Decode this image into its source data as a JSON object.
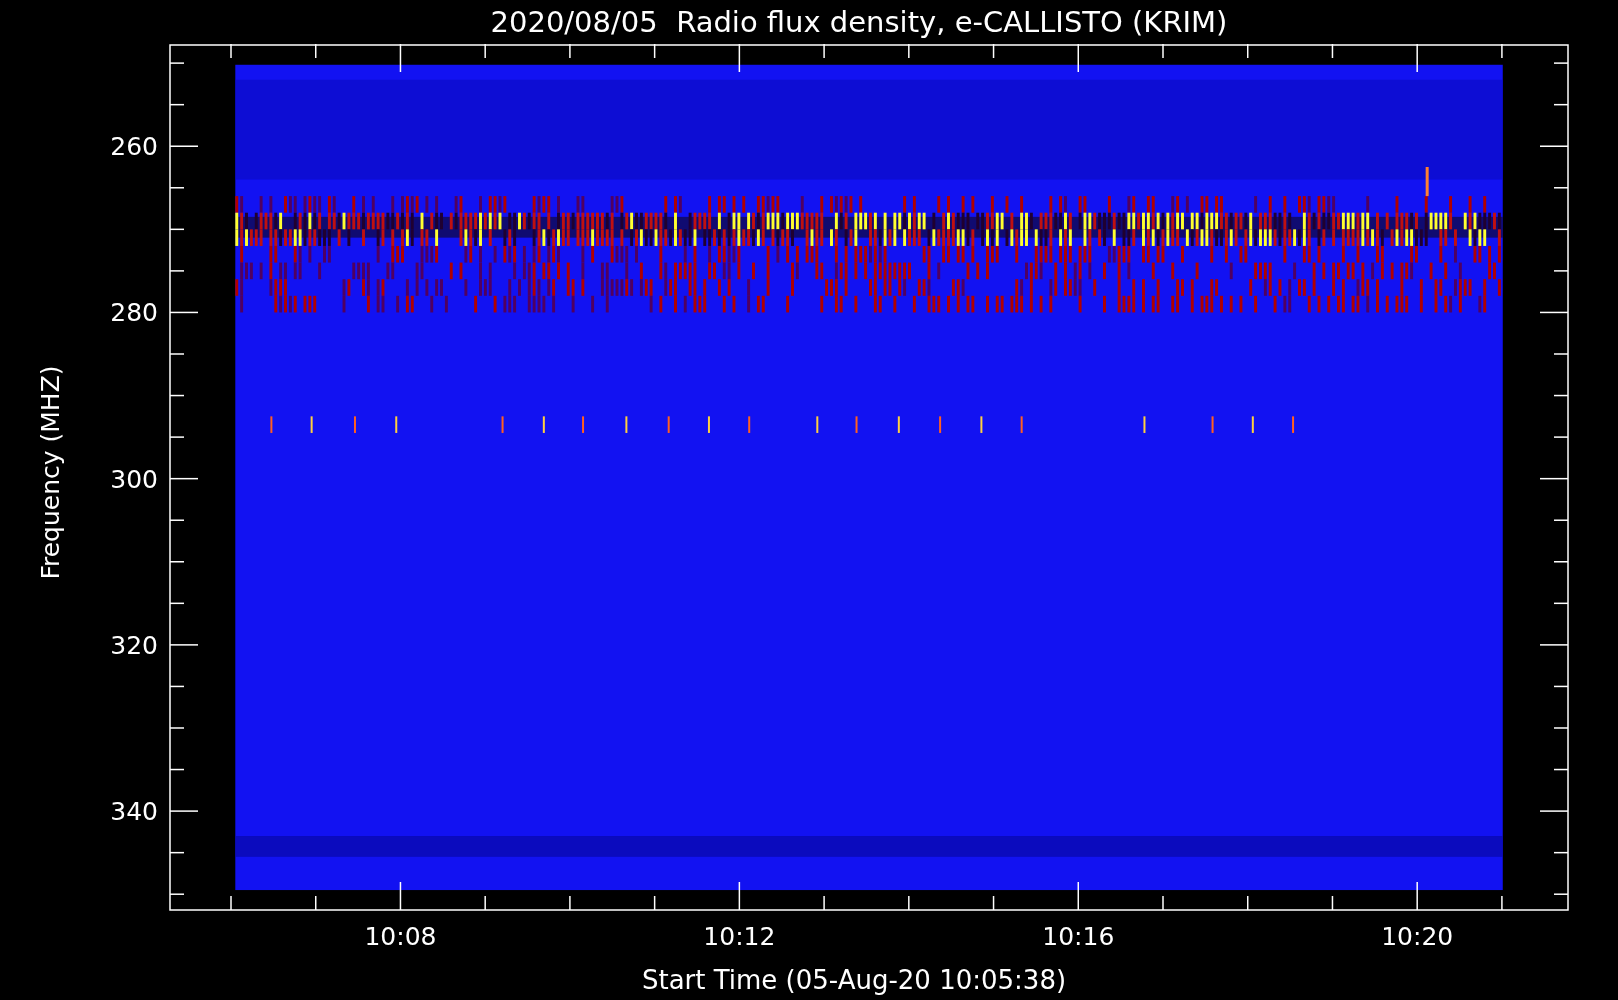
{
  "plot": {
    "title": "2020/08/05  Radio flux density, e-CALLISTO (KRIM)",
    "xlabel": "Start Time (05-Aug-20 10:05:38)",
    "ylabel": "Frequency (MHZ)",
    "xticks": [
      "10:08",
      "10:12",
      "10:16",
      "10:20"
    ],
    "yticks": [
      "260",
      "280",
      "300",
      "320",
      "340"
    ]
  }
}
